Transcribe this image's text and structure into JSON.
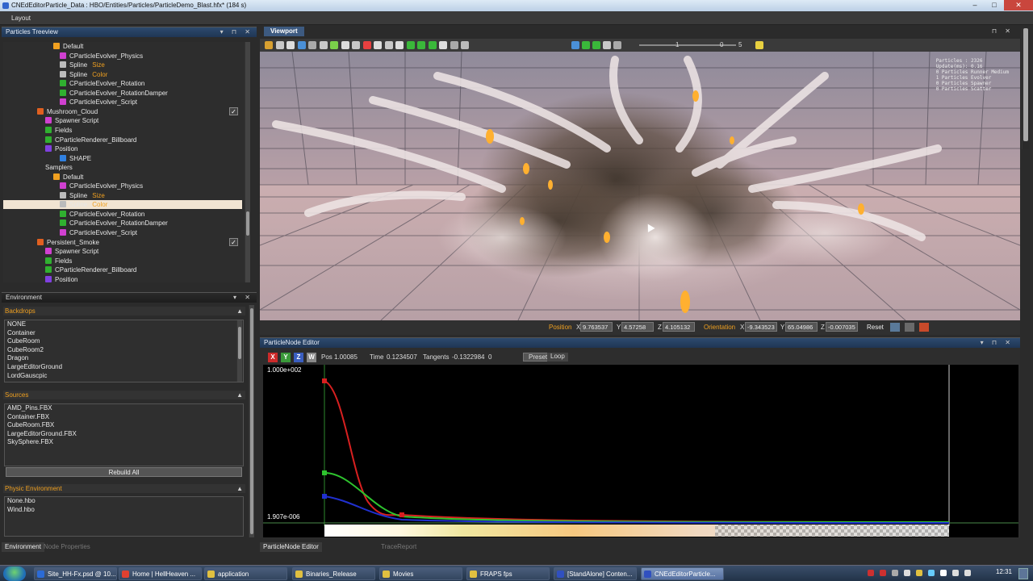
{
  "window": {
    "title": "CNEdEditorParticle_Data : HBO/Entities/Particles/ParticleDemo_Blast.hfx* (184 s)",
    "min": "–",
    "max": "□",
    "close": "✕"
  },
  "menu": {
    "layout": "Layout"
  },
  "tree_panel": {
    "title": "Particles Treeview",
    "buttons": "▾ ⊓ ✕",
    "items": [
      {
        "label": "Default",
        "icon": "evolver-group-icon",
        "color": "#f0a020",
        "dot": "brace"
      },
      {
        "label": "CParticleEvolver_Physics",
        "icon": "evolver-icon",
        "color": "#d040d0"
      },
      {
        "label": "Spline",
        "extra": "Size",
        "icon": "spline-icon",
        "color": "#bbb"
      },
      {
        "label": "Spline",
        "extra": "Color",
        "icon": "spline-icon",
        "color": "#bbb"
      },
      {
        "label": "CParticleEvolver_Rotation",
        "icon": "evolver-icon",
        "color": "#30b030"
      },
      {
        "label": "CParticleEvolver_RotationDamper",
        "icon": "evolver-icon",
        "color": "#30b030"
      },
      {
        "label": "CParticleEvolver_Script",
        "icon": "script-icon",
        "color": "#d040d0"
      },
      {
        "label": "Mushroom_Cloud",
        "icon": "emitter-icon",
        "color": "#e06020",
        "check": true
      },
      {
        "label": "Spawner Script",
        "icon": "script-icon",
        "color": "#d040d0"
      },
      {
        "label": "Fields",
        "icon": "field-icon",
        "color": "#30b030"
      },
      {
        "label": "CParticleRenderer_Billboard",
        "icon": "renderer-icon",
        "color": "#30b030"
      },
      {
        "label": "Position",
        "icon": "sampler-icon",
        "color": "#8040e0"
      },
      {
        "label": "SHAPE",
        "icon": "shape-icon",
        "color": "#3080e0"
      },
      {
        "label": "Samplers",
        "icon": "",
        "color": ""
      },
      {
        "label": "Default",
        "icon": "evolver-group-icon",
        "color": "#f0a020"
      },
      {
        "label": "CParticleEvolver_Physics",
        "icon": "evolver-icon",
        "color": "#d040d0"
      },
      {
        "label": "Spline",
        "extra": "Size",
        "icon": "spline-icon",
        "color": "#bbb"
      },
      {
        "label": "Spline",
        "extra": "Color",
        "icon": "spline-icon",
        "color": "#bbb",
        "selected": true
      },
      {
        "label": "CParticleEvolver_Rotation",
        "icon": "evolver-icon",
        "color": "#30b030"
      },
      {
        "label": "CParticleEvolver_RotationDamper",
        "icon": "evolver-icon",
        "color": "#30b030"
      },
      {
        "label": "CParticleEvolver_Script",
        "icon": "script-icon",
        "color": "#d040d0"
      },
      {
        "label": "Persistent_Smoke",
        "icon": "emitter-icon",
        "color": "#e06020",
        "check": true
      },
      {
        "label": "Spawner Script",
        "icon": "script-icon",
        "color": "#d040d0"
      },
      {
        "label": "Fields",
        "icon": "field-icon",
        "color": "#30b030"
      },
      {
        "label": "CParticleRenderer_Billboard",
        "icon": "renderer-icon",
        "color": "#30b030"
      },
      {
        "label": "Position",
        "icon": "sampler-icon",
        "color": "#8040e0"
      }
    ]
  },
  "env_panel": {
    "title": "Environment",
    "buttons": "▾ ✕",
    "backdrops_title": "Backdrops",
    "backdrops": [
      "NONE",
      "Container",
      "CubeRoom",
      "CubeRoom2",
      "Dragon",
      "LargeEditorGround",
      "LordGauscpic"
    ],
    "sources_title": "Sources",
    "sources": [
      "AMD_Pins.FBX",
      "Container.FBX",
      "CubeRoom.FBX",
      "LargeEditorGround.FBX",
      "SkySphere.FBX"
    ],
    "rebuild": "Rebuild All",
    "physic_title": "Physic Environment",
    "physic": [
      "None.hbo",
      "Wind.hbo"
    ]
  },
  "bottom_tabs_left": [
    "Environment",
    "Node Properties"
  ],
  "bottom_tabs_right": [
    "ParticleNode Editor",
    "TraceReport"
  ],
  "viewport": {
    "title": "Viewport",
    "zoom_a": "1",
    "zoom_b": "0",
    "zoom_c": "5",
    "stats": [
      "Particles : 2326",
      "Update(ms): 0.16",
      "0 Particles Runner Medium",
      "1 Particles Evolver",
      "0 Particles Spawner",
      "0 Particles Scatter"
    ]
  },
  "vp_status": {
    "position_label": "Position",
    "x_label": "X",
    "x": "9.763537",
    "y_label": "Y",
    "y": "4.57258",
    "z_label": "Z",
    "z": "4.105132",
    "orientation_label": "Orientation",
    "ox": "-9.343523",
    "oy": "65.04986",
    "oz": "-0.007035",
    "reset": "Reset"
  },
  "pn_editor": {
    "title": "ParticleNode Editor",
    "buttons": "▾ ⊓ ✕",
    "x_btn": "X",
    "y_btn": "Y",
    "z_btn": "Z",
    "w_btn": "W",
    "pos_label": "Pos",
    "pos": "1.00085",
    "time_label": "Time",
    "time": "0.1234507",
    "tangents_label": "Tangents",
    "tangents": "-0.1322984",
    "tangents2": "0",
    "preset": "Preset",
    "loop": "Loop",
    "ymax": "1.000e+002",
    "ymin": "1.907e-006"
  },
  "taskbar": {
    "items": [
      {
        "label": "Site_HH-Fx.psd @ 10...",
        "color": "#2b6bd6"
      },
      {
        "label": "Home | HellHeaven ...",
        "color": "#e04030"
      },
      {
        "label": "application",
        "color": "#e0c040"
      },
      {
        "label": "Binaries_Release",
        "color": "#e0c040"
      },
      {
        "label": "Movies",
        "color": "#e0c040"
      },
      {
        "label": "FRAPS fps",
        "color": "#e0c040"
      },
      {
        "label": "[StandAlone] Conten...",
        "color": "#3050c0"
      },
      {
        "label": "CNEdEditorParticle...",
        "color": "#3050c0",
        "active": true
      }
    ],
    "clock": "12:31"
  }
}
